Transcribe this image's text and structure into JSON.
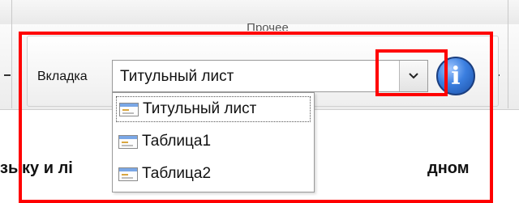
{
  "ribbon": {
    "group_title": "Прочее",
    "tab_label": "Вкладка",
    "combo_value": "Титульный лист",
    "combo_arrow_icon": "chevron-down-icon",
    "info_icon": "info-icon",
    "info_glyph": "i"
  },
  "dropdown": {
    "items": [
      {
        "label": "Титульный лист",
        "selected": true
      },
      {
        "label": "Таблица1",
        "selected": false
      },
      {
        "label": "Таблица2",
        "selected": false
      }
    ]
  },
  "document": {
    "text_left": "зыку и лі",
    "text_right": "дном"
  },
  "colors": {
    "highlight": "#ff0000",
    "info_blue": "#3b7fe0"
  }
}
